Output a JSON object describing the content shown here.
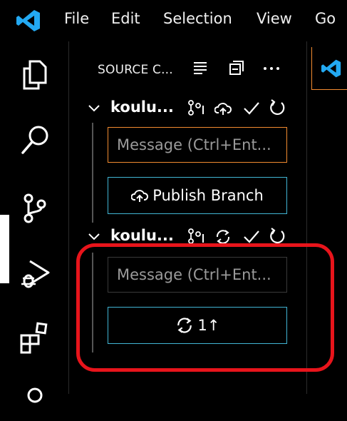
{
  "menubar": {
    "items": [
      "File",
      "Edit",
      "Selection",
      "View",
      "Go"
    ]
  },
  "activitybar": {
    "icons": [
      "explorer-icon",
      "search-icon",
      "source-control-icon",
      "run-debug-icon",
      "extensions-icon"
    ],
    "active": "source-control-icon"
  },
  "sidebar": {
    "title": "SOURCE C...",
    "header_icons": [
      "view-as-tree-icon",
      "collapse-all-icon",
      "more-actions-icon"
    ],
    "repos": [
      {
        "name": "koulu...",
        "icons": [
          "branch-icon",
          "cloud-icon",
          "commit-check-icon",
          "refresh-icon"
        ],
        "message_placeholder": "Message (Ctrl+Ent...",
        "button_label": "Publish Branch",
        "button_icon": "cloud-upload-icon"
      },
      {
        "name": "koulu...",
        "icons": [
          "branch-icon",
          "sync-icon",
          "commit-check-icon",
          "refresh-icon"
        ],
        "message_placeholder": "Message (Ctrl+Ent...",
        "button_label": "1↑",
        "button_icon": "sync-icon"
      }
    ]
  },
  "colors": {
    "accent_focus": "#f28b30",
    "button_border": "#41b5d4",
    "highlight": "#e8141b",
    "logo": "#23a9f2"
  }
}
